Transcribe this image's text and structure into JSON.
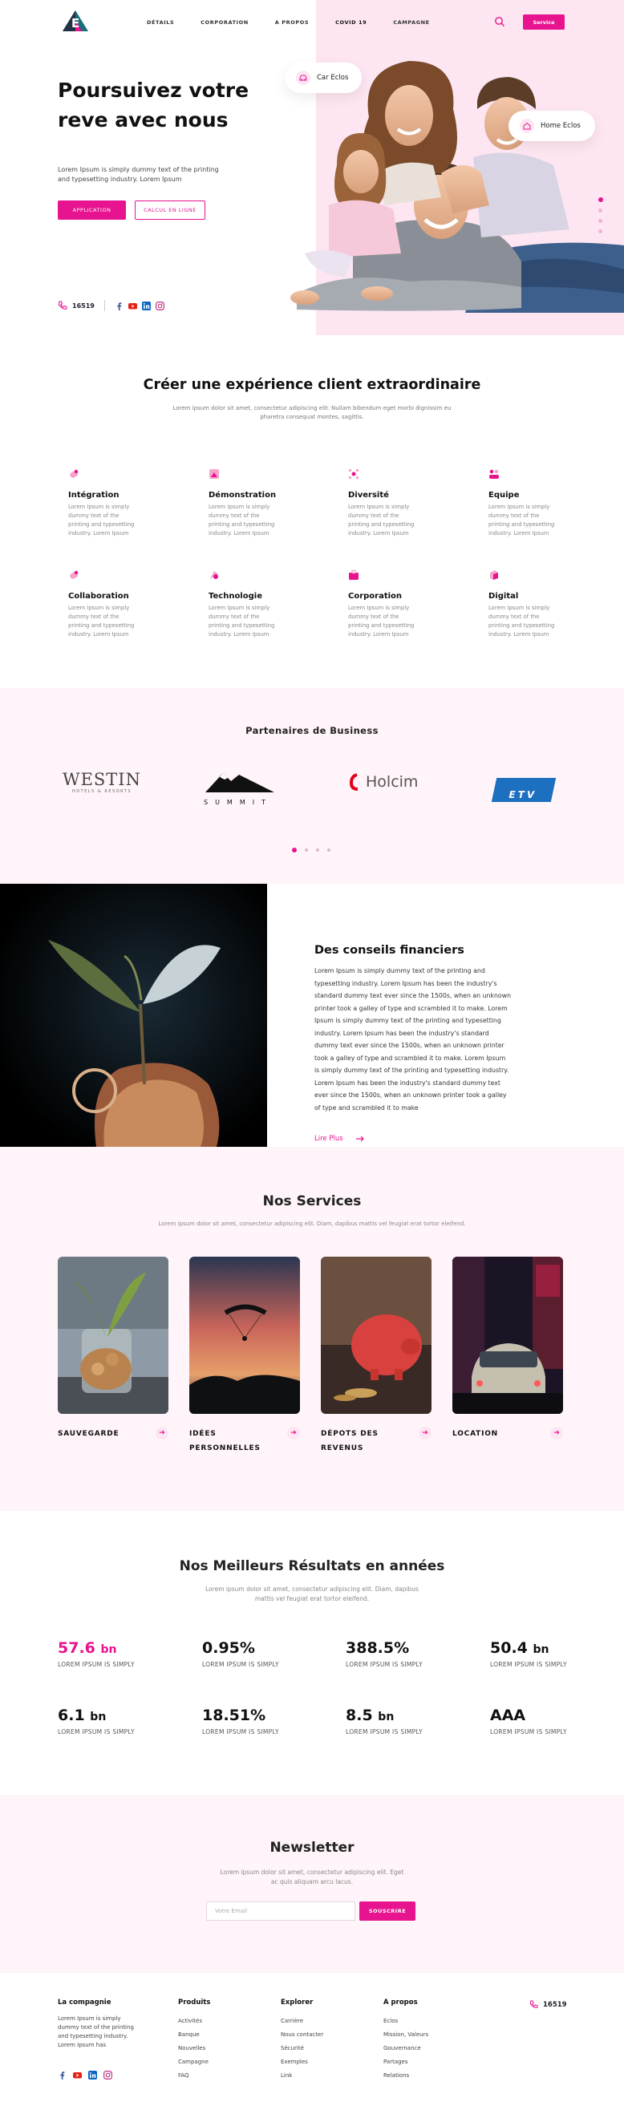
{
  "nav": {
    "links": [
      "DÉTAILS",
      "CORPORATION",
      "A PROPOS",
      "COVID 19",
      "CAMPAGNE"
    ],
    "service_btn": "Service"
  },
  "hero": {
    "title": "Poursuivez votre reve avec nous",
    "text": "Lorem Ipsum is simply dummy text of the printing and typesetting industry. Lorem Ipsum",
    "btn_app": "APPLICATION",
    "btn_calc": "CALCUL EN LIGNE",
    "phone": "16519",
    "card1": "Car Eclos",
    "card2": "Home Eclos"
  },
  "experience": {
    "title": "Créer une expérience client extraordinaire",
    "subtitle": "Lorem ipsum dolor sit amet, consectetur adipiscing elit. Nullam bibendum eget morbi dignissim eu pharetra consequat montes, sagittis.",
    "features": [
      {
        "title": "Intégration",
        "desc": "Lorem Ipsum is simply dummy text of the printing and typesetting industry. Lorem Ipsum"
      },
      {
        "title": "Démonstration",
        "desc": "Lorem Ipsum is simply dummy text of the printing and typesetting industry. Lorem Ipsum"
      },
      {
        "title": "Diversité",
        "desc": "Lorem Ipsum is simply dummy text of the printing and typesetting industry. Lorem Ipsum"
      },
      {
        "title": "Equipe",
        "desc": "Lorem Ipsum is simply dummy text of the printing and typesetting industry. Lorem Ipsum"
      },
      {
        "title": "Collaboration",
        "desc": "Lorem Ipsum is simply dummy text of the printing and typesetting industry. Lorem Ipsum"
      },
      {
        "title": "Technologie",
        "desc": "Lorem Ipsum is simply dummy text of the printing and typesetting industry. Lorem Ipsum"
      },
      {
        "title": "Corporation",
        "desc": "Lorem Ipsum is simply dummy text of the printing and typesetting industry. Lorem Ipsum"
      },
      {
        "title": "Digital",
        "desc": "Lorem Ipsum is simply dummy text of the printing and typesetting industry. Lorem Ipsum"
      }
    ]
  },
  "partners": {
    "title": "Partenaires de Business",
    "logos": [
      "WESTIN",
      "HOTELS & RESORTS",
      "SUMMIT",
      "Holcim",
      "ETV"
    ]
  },
  "finance": {
    "title": "Des conseils financiers",
    "text": "Lorem Ipsum is simply dummy text of the printing and typesetting industry. Lorem Ipsum has been the industry's standard dummy text ever since the 1500s, when an unknown printer took a galley of type and scrambled it to make. Lorem Ipsum is simply dummy text of the printing and typesetting industry. Lorem Ipsum has been the industry's standard dummy text ever since the 1500s, when an unknown printer took a galley of type and scrambled it to make. Lorem Ipsum is simply dummy text of the printing and typesetting industry. Lorem Ipsum has been the industry's standard dummy text ever since the 1500s, when an unknown printer took a galley of type and scrambled it to make",
    "link": "Lire Plus"
  },
  "services": {
    "title": "Nos Services",
    "subtitle": "Lorem ipsum dolor sit amet, consectetur adipiscing elit. Diam, dapibus mattis vel feugiat erat tortor eleifend.",
    "items": [
      "SAUVEGARDE",
      "IDÉES PERSONNELLES",
      "DÉPOTS DES REVENUS",
      "LOCATION"
    ]
  },
  "results": {
    "title": "Nos Meilleurs Résultats en années",
    "subtitle": "Lorem ipsum dolor sit amet, consectetur adipiscing elit. Diam, dapibus mattis vel feugiat erat tortor eleifend.",
    "stats": [
      {
        "value": "57.6",
        "unit": "bn",
        "label": "LOREM IPSUM IS SIMPLY"
      },
      {
        "value": "0.95%",
        "unit": "",
        "label": "LOREM IPSUM IS SIMPLY"
      },
      {
        "value": "388.5%",
        "unit": "",
        "label": "LOREM IPSUM IS SIMPLY"
      },
      {
        "value": "50.4",
        "unit": "bn",
        "label": "LOREM IPSUM IS SIMPLY"
      },
      {
        "value": "6.1",
        "unit": "bn",
        "label": "LOREM IPSUM IS SIMPLY"
      },
      {
        "value": "18.51%",
        "unit": "",
        "label": "LOREM IPSUM IS SIMPLY"
      },
      {
        "value": "8.5",
        "unit": "bn",
        "label": "LOREM IPSUM IS SIMPLY"
      },
      {
        "value": "AAA",
        "unit": "",
        "label": "LOREM IPSUM IS SIMPLY"
      }
    ]
  },
  "newsletter": {
    "title": "Newsletter",
    "subtitle": "Lorem ipsum dolor sit amet, consectetur adipiscing elit. Eget ac quis aliquam arcu lacus.",
    "placeholder": "Votre Email",
    "button": "SOUSCRIRE"
  },
  "footer": {
    "company_title": "La compagnie",
    "company_text": "Lorem Ipsum is simply dummy text of the printing and typesetting industry. Lorem Ipsum has",
    "col2_title": "Produits",
    "col2": [
      "Activités",
      "Banque",
      "Nouvelles",
      "Campagne",
      "FAQ"
    ],
    "col3_title": "Explorer",
    "col3": [
      "Carrière",
      "Nous contacter",
      "Sécurité",
      "Exemples",
      "Link"
    ],
    "col4_title": "A propos",
    "col4": [
      "Eclos",
      "Mission, Valeurs",
      "Gouvernance",
      "Partages",
      "Relations"
    ],
    "phone": "16519"
  },
  "colors": {
    "accent": "#e8138f",
    "pink_bg": "#fde6f1",
    "light_bg": "#fff4f9"
  }
}
